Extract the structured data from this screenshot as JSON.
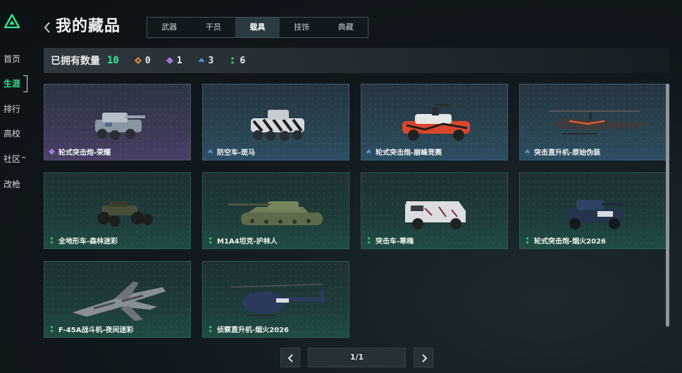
{
  "sidebar": {
    "logo_icon": "triangle-logo-icon",
    "items": [
      {
        "label": "首页"
      },
      {
        "label": "生涯",
        "active": true
      },
      {
        "label": "排行"
      },
      {
        "label": "高校"
      },
      {
        "label": "社区",
        "caret": "^"
      },
      {
        "label": "改枪"
      }
    ]
  },
  "header": {
    "back_icon": "chevron-left-icon",
    "title": "我的藏品",
    "tabs": [
      {
        "label": "武器"
      },
      {
        "label": "干员"
      },
      {
        "label": "载具",
        "active": true
      },
      {
        "label": "挂饰"
      },
      {
        "label": "典藏"
      }
    ]
  },
  "summary": {
    "label": "已拥有数量",
    "total": "10",
    "rarities": [
      {
        "icon": "orange-diamond-icon",
        "color": "#e38a3b",
        "count": "0"
      },
      {
        "icon": "purple-diamond-icon",
        "color": "#a77be6",
        "count": "1"
      },
      {
        "icon": "blue-chevron-icon",
        "color": "#4f96dc",
        "count": "3"
      },
      {
        "icon": "green-dots-icon",
        "color": "#34d18a",
        "count": "6"
      }
    ]
  },
  "colors": {
    "accent": "#33e08e",
    "purple": "#a77be6",
    "blue": "#4f96dc",
    "green": "#34d18a"
  },
  "items": [
    {
      "name": "轮式突击炮-荣耀",
      "rarity": "purple",
      "vehicle": "wheeled-assault-gun"
    },
    {
      "name": "防空车-斑马",
      "rarity": "blue",
      "vehicle": "anti-air-vehicle"
    },
    {
      "name": "轮式突击炮-崩峰竞赛",
      "rarity": "blue",
      "vehicle": "wheeled-assault-gun-red"
    },
    {
      "name": "突击直升机-原始伪装",
      "rarity": "blue",
      "vehicle": "attack-helicopter"
    },
    {
      "name": "全地形车-森林迷彩",
      "rarity": "green",
      "vehicle": "atv"
    },
    {
      "name": "M1A4坦克-护林人",
      "rarity": "green",
      "vehicle": "tank"
    },
    {
      "name": "突击车-寒梅",
      "rarity": "green",
      "vehicle": "armored-car"
    },
    {
      "name": "轮式突击炮-烟火2026",
      "rarity": "green",
      "vehicle": "wheeled-assault-gun-dark"
    },
    {
      "name": "F-45A战斗机-夜间迷彩",
      "rarity": "green",
      "vehicle": "fighter-jet"
    },
    {
      "name": "侦察直升机-烟火2026",
      "rarity": "green",
      "vehicle": "scout-helicopter"
    }
  ],
  "pager": {
    "prev_icon": "chevron-left-icon",
    "next_icon": "chevron-right-icon",
    "text": "1/1"
  }
}
